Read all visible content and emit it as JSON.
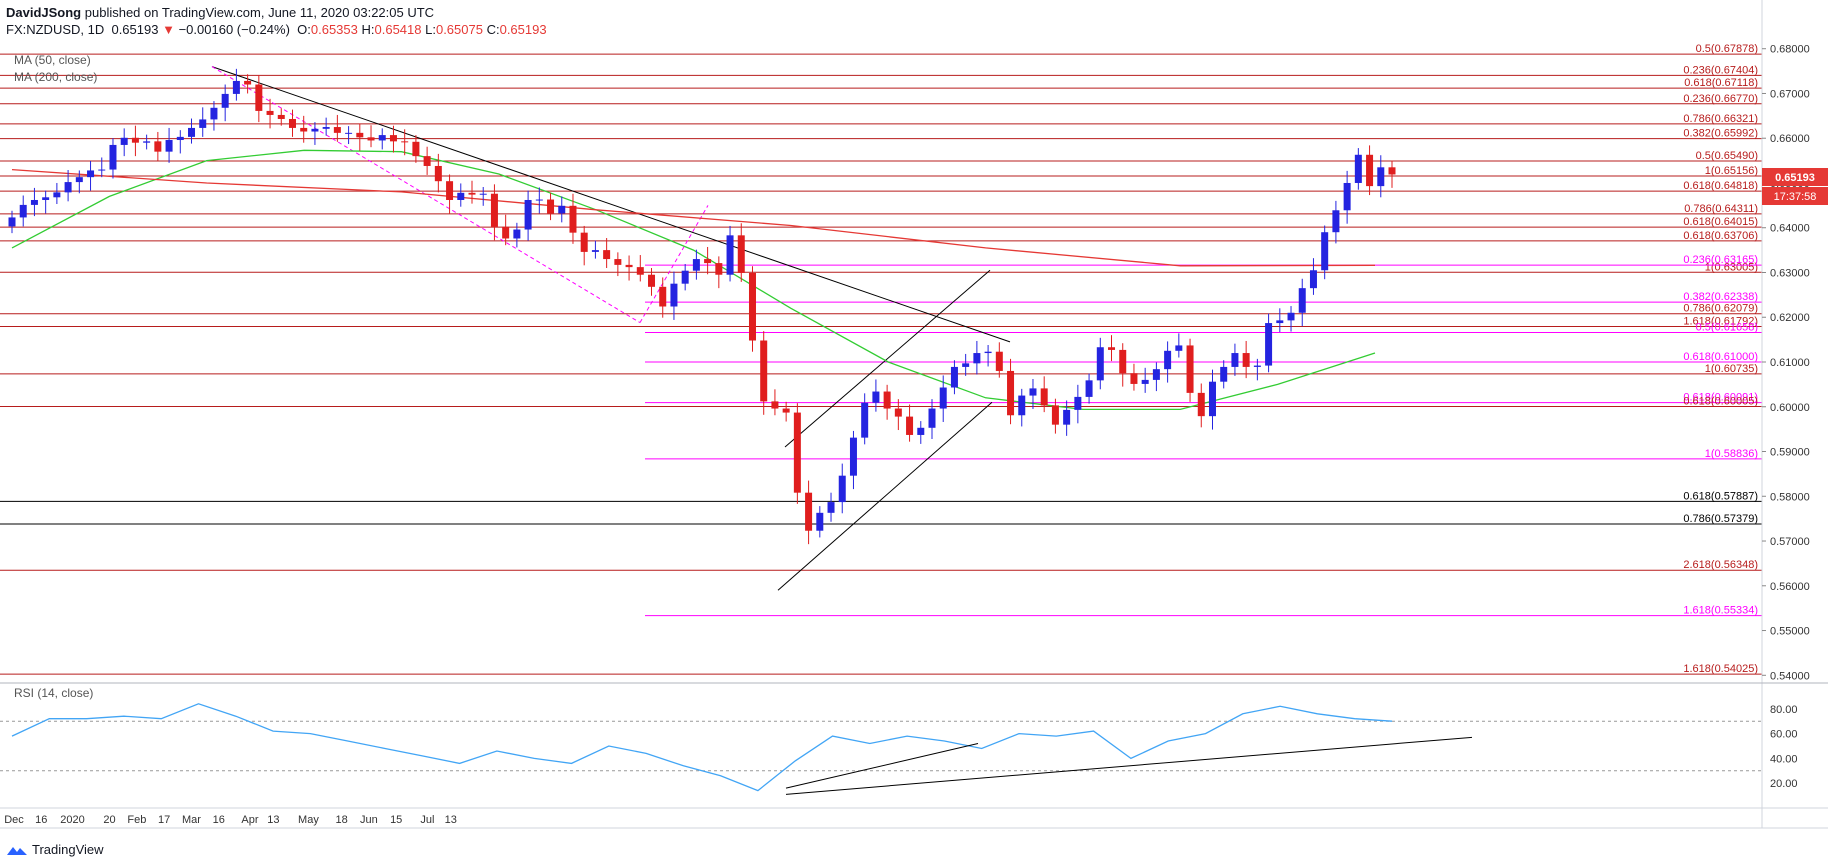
{
  "header": {
    "author": "DavidJSong",
    "published_text": "published on TradingView.com, June 11, 2020 03:22:05 UTC",
    "symbol": "FX:NZDUSD, 1D",
    "last": "0.65193",
    "change_arrow": "▼",
    "change": "−0.00160 (−0.24%)",
    "open_label": "O:",
    "open": "0.65353",
    "high_label": "H:",
    "high": "0.65418",
    "low_label": "L:",
    "low": "0.65075",
    "close_label": "C:",
    "close": "0.65193"
  },
  "legend": {
    "ma50": "MA (50, close)",
    "ma200": "MA (200, close)",
    "rsi": "RSI (14, close)"
  },
  "price_tag": {
    "price": "0.65193",
    "countdown": "17:37:58"
  },
  "footer": {
    "brand": "TradingView"
  },
  "colors": {
    "up": "#2424e0",
    "down": "#e01e1e",
    "ma50": "#33cc33",
    "ma200": "#e53935",
    "rsi": "#42a5f5",
    "fib_pink": "#ff00ff",
    "fib_red": "#b71c1c",
    "fib_black": "#000000"
  },
  "chart_data": {
    "type": "candlestick",
    "symbol": "FX:NZDUSD",
    "interval": "1D",
    "y_range": [
      0.5385,
      0.6815
    ],
    "y_ticks": [
      "0.68000",
      "0.67000",
      "0.66000",
      "0.65000",
      "0.64000",
      "0.63000",
      "0.62000",
      "0.61000",
      "0.60000",
      "0.59000",
      "0.58000",
      "0.57000",
      "0.56000",
      "0.55000",
      "0.54000"
    ],
    "x_ticks": [
      {
        "label": "Dec",
        "date": "2019-12-02"
      },
      {
        "label": "16",
        "date": "2019-12-16"
      },
      {
        "label": "2020",
        "date": "2020-01-01"
      },
      {
        "label": "20",
        "date": "2020-01-20"
      },
      {
        "label": "Feb",
        "date": "2020-02-03"
      },
      {
        "label": "17",
        "date": "2020-02-17"
      },
      {
        "label": "Mar",
        "date": "2020-03-02"
      },
      {
        "label": "16",
        "date": "2020-03-16"
      },
      {
        "label": "Apr",
        "date": "2020-04-01"
      },
      {
        "label": "13",
        "date": "2020-04-13"
      },
      {
        "label": "May",
        "date": "2020-05-01"
      },
      {
        "label": "18",
        "date": "2020-05-18"
      },
      {
        "label": "Jun",
        "date": "2020-06-01"
      },
      {
        "label": "15",
        "date": "2020-06-15"
      },
      {
        "label": "Jul",
        "date": "2020-07-01"
      },
      {
        "label": "13",
        "date": "2020-07-13"
      }
    ],
    "candles_close_approx": [
      0.6423,
      0.6451,
      0.6462,
      0.6468,
      0.6479,
      0.6502,
      0.6513,
      0.6528,
      0.653,
      0.6585,
      0.6601,
      0.659,
      0.6593,
      0.657,
      0.6596,
      0.6603,
      0.6623,
      0.6642,
      0.6668,
      0.6699,
      0.6728,
      0.672,
      0.6661,
      0.6652,
      0.6643,
      0.6623,
      0.6615,
      0.6621,
      0.6625,
      0.6612,
      0.6612,
      0.6602,
      0.6595,
      0.6607,
      0.6593,
      0.6592,
      0.656,
      0.6538,
      0.6504,
      0.6462,
      0.6478,
      0.6474,
      0.6476,
      0.6402,
      0.6376,
      0.6396,
      0.6462,
      0.6463,
      0.6432,
      0.6449,
      0.6389,
      0.6346,
      0.635,
      0.633,
      0.6317,
      0.6312,
      0.6295,
      0.6268,
      0.6224,
      0.6275,
      0.6304,
      0.633,
      0.6321,
      0.6295,
      0.6383,
      0.6299,
      0.6148,
      0.6012,
      0.5996,
      0.5987,
      0.5808,
      0.5723,
      0.5763,
      0.5787,
      0.5846,
      0.5931,
      0.6009,
      0.6034,
      0.5996,
      0.5978,
      0.5937,
      0.5953,
      0.5996,
      0.6043,
      0.6089,
      0.6097,
      0.612,
      0.6123,
      0.608,
      0.5981,
      0.6025,
      0.6041,
      0.6003,
      0.596,
      0.5993,
      0.6022,
      0.6059,
      0.6133,
      0.6127,
      0.6075,
      0.6051,
      0.606,
      0.6084,
      0.6125,
      0.6137,
      0.6031,
      0.5979,
      0.6056,
      0.6089,
      0.612,
      0.6089,
      0.6092,
      0.6187,
      0.6193,
      0.621,
      0.6265,
      0.6305,
      0.639,
      0.6439,
      0.65,
      0.6563,
      0.6493,
      0.6535,
      0.6519
    ],
    "series": [
      {
        "name": "MA (50, close)",
        "values_approx": [
          0.6355,
          0.647,
          0.655,
          0.6573,
          0.657,
          0.652,
          0.644,
          0.635,
          0.622,
          0.61,
          0.602,
          0.5994,
          0.5994,
          0.605,
          0.612
        ]
      },
      {
        "name": "MA (200, close)",
        "values_approx": [
          0.653,
          0.65,
          0.648,
          0.644,
          0.6405,
          0.6355,
          0.6315,
          0.6316
        ]
      },
      {
        "name": "RSI (14, close)",
        "values_approx": [
          58,
          72,
          72,
          74,
          72,
          84,
          74,
          62,
          60,
          54,
          48,
          42,
          36,
          46,
          40,
          36,
          50,
          44,
          34,
          26,
          14,
          38,
          58,
          52,
          58,
          54,
          48,
          60,
          58,
          62,
          40,
          54,
          60,
          76,
          82,
          76,
          72,
          70
        ]
      }
    ],
    "rsi_range": [
      0,
      100
    ],
    "rsi_levels": [
      70,
      30
    ],
    "rsi_ticks": [
      "80.00",
      "60.00",
      "40.00",
      "20.00"
    ],
    "levels": [
      {
        "label": "0.5(0.67878)",
        "value": 0.67878,
        "color": "#b71c1c"
      },
      {
        "label": "0.236(0.67404)",
        "value": 0.67404,
        "color": "#b71c1c"
      },
      {
        "label": "0.618(0.67118)",
        "value": 0.67118,
        "color": "#b71c1c"
      },
      {
        "label": "0.236(0.66770)",
        "value": 0.6677,
        "color": "#b71c1c"
      },
      {
        "label": "0.786(0.66321)",
        "value": 0.66321,
        "color": "#b71c1c"
      },
      {
        "label": "0.382(0.65992)",
        "value": 0.65992,
        "color": "#b71c1c"
      },
      {
        "label": "0.5(0.65490)",
        "value": 0.6549,
        "color": "#b71c1c"
      },
      {
        "label": "1(0.65156)",
        "value": 0.65156,
        "color": "#b71c1c"
      },
      {
        "label": "0.618(0.64818)",
        "value": 0.64818,
        "color": "#b71c1c"
      },
      {
        "label": "0.786(0.64311)",
        "value": 0.64311,
        "color": "#b71c1c"
      },
      {
        "label": "0.618(0.64015)",
        "value": 0.64015,
        "color": "#b71c1c"
      },
      {
        "label": "0.618(0.63706)",
        "value": 0.63706,
        "color": "#b71c1c"
      },
      {
        "label": "1(0.63005)",
        "value": 0.63005,
        "color": "#b71c1c"
      },
      {
        "label": "0.236(0.63165)",
        "value": 0.63165,
        "color": "#ff00ff"
      },
      {
        "label": "0.382(0.62338)",
        "value": 0.62338,
        "color": "#ff00ff"
      },
      {
        "label": "0.786(0.62079)",
        "value": 0.62079,
        "color": "#b71c1c"
      },
      {
        "label": "1.618(0.61792)",
        "value": 0.61792,
        "color": "#b71c1c"
      },
      {
        "label": "0.5(0.61658)",
        "value": 0.61658,
        "color": "#ff00ff"
      },
      {
        "label": "0.618(0.61000)",
        "value": 0.61,
        "color": "#ff00ff"
      },
      {
        "label": "1(0.60735)",
        "value": 0.60735,
        "color": "#b71c1c"
      },
      {
        "label": "0.618(0.60091)",
        "value": 0.60091,
        "color": "#ff00ff"
      },
      {
        "label": "0.618(0.60005)",
        "value": 0.60005,
        "color": "#b71c1c"
      },
      {
        "label": "1(0.58836)",
        "value": 0.58836,
        "color": "#ff00ff"
      },
      {
        "label": "0.618(0.57887)",
        "value": 0.57887,
        "color": "#000000"
      },
      {
        "label": "0.786(0.57379)",
        "value": 0.57379,
        "color": "#000000"
      },
      {
        "label": "2.618(0.56348)",
        "value": 0.56348,
        "color": "#b71c1c"
      },
      {
        "label": "1.618(0.55334)",
        "value": 0.55334,
        "color": "#ff00ff"
      },
      {
        "label": "1.618(0.54025)",
        "value": 0.54025,
        "color": "#b71c1c"
      }
    ]
  }
}
